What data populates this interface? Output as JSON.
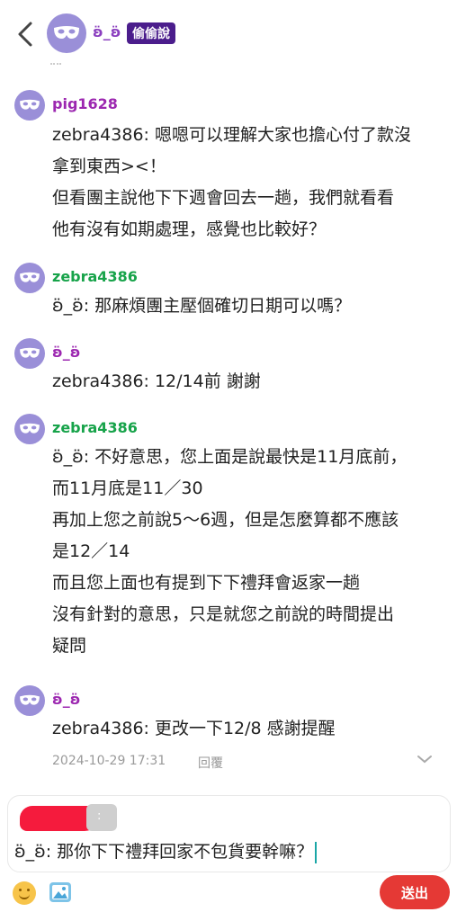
{
  "header": {
    "title": "ʚ̈_ʚ̈",
    "badge": "偷偷說"
  },
  "messages": [
    {
      "author": "pig1628",
      "author_color": "#9c27b0",
      "lines": [
        "zebra4386: 嗯嗯可以理解大家也擔心付了款沒",
        "拿到東西><！",
        "但看團主說他下下週會回去一趟，我們就看看",
        "他有沒有如期處理，感覺也比較好？"
      ]
    },
    {
      "author": "zebra4386",
      "author_color": "#17a34a",
      "lines": [
        "ʚ̈_ʚ̈: 那麻煩團主壓個確切日期可以嗎？"
      ]
    },
    {
      "author": "ʚ̈_ʚ̈",
      "author_color": "#9c27b0",
      "lines": [
        "zebra4386: 12/14前 謝謝"
      ]
    },
    {
      "author": "zebra4386",
      "author_color": "#17a34a",
      "lines": [
        "ʚ̈_ʚ̈: 不好意思，您上面是說最快是11月底前，",
        "而11月底是11／30",
        "再加上您之前說5～6週，但是怎麼算都不應該",
        "是12／14",
        "而且您上面也有提到下下禮拜會返家一趟",
        "沒有針對的意思，只是就您之前說的時間提出",
        "疑問"
      ]
    },
    {
      "author": "ʚ̈_ʚ̈",
      "author_color": "#9c27b0",
      "lines": [
        "zebra4386: 更改一下12/8 感謝提醒"
      ],
      "timestamp": "2024-10-29 17:31",
      "reply_label": "回覆"
    }
  ],
  "composer": {
    "chip_glyph": ":",
    "draft": "ʚ̈_ʚ̈: 那你下下禮拜回家不包貨要幹嘛？",
    "send_label": "送出"
  },
  "icons": [
    "back-arrow-icon",
    "mask-icon",
    "chevron-down-icon",
    "emoji-icon",
    "image-icon"
  ],
  "colors": {
    "accent_purple": "#9c27b0",
    "accent_green": "#17a34a",
    "send_red": "#e53935",
    "badge_bg": "#4b1d8c"
  }
}
